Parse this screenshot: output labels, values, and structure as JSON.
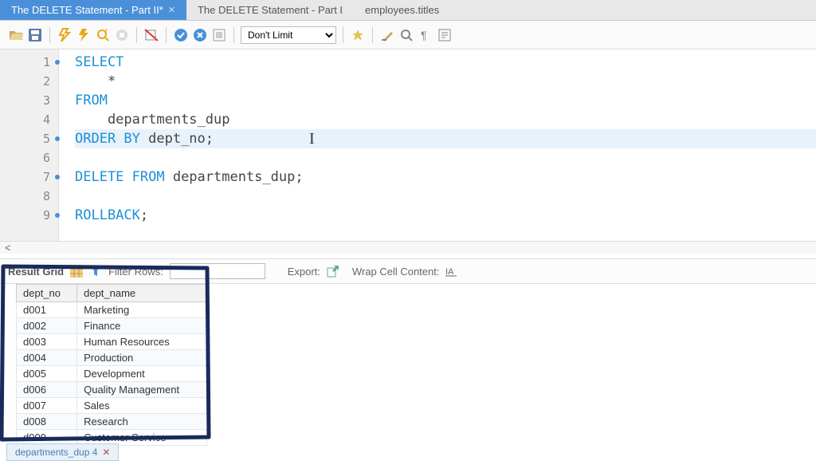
{
  "tabs": [
    {
      "label": "The DELETE Statement - Part II*",
      "active": true
    },
    {
      "label": "The DELETE Statement - Part I",
      "active": false
    },
    {
      "label": "employees.titles",
      "active": false
    }
  ],
  "toolbar": {
    "limit_label": "Don't Limit"
  },
  "editor": {
    "lines": [
      {
        "n": 1,
        "dot": true,
        "tokens": [
          {
            "t": "SELECT",
            "c": "kw"
          }
        ]
      },
      {
        "n": 2,
        "dot": false,
        "tokens": [
          {
            "t": "    *",
            "c": "txt"
          }
        ]
      },
      {
        "n": 3,
        "dot": false,
        "tokens": [
          {
            "t": "FROM",
            "c": "kw"
          }
        ]
      },
      {
        "n": 4,
        "dot": false,
        "tokens": [
          {
            "t": "    departments_dup",
            "c": "txt"
          }
        ]
      },
      {
        "n": 5,
        "dot": true,
        "tokens": [
          {
            "t": "ORDER BY",
            "c": "kw"
          },
          {
            "t": " dept_no;",
            "c": "txt"
          }
        ],
        "highlight": true,
        "cursor": true
      },
      {
        "n": 6,
        "dot": false,
        "tokens": []
      },
      {
        "n": 7,
        "dot": true,
        "tokens": [
          {
            "t": "DELETE FROM",
            "c": "kw"
          },
          {
            "t": " departments_dup;",
            "c": "txt"
          }
        ]
      },
      {
        "n": 8,
        "dot": false,
        "tokens": []
      },
      {
        "n": 9,
        "dot": true,
        "tokens": [
          {
            "t": "ROLLBACK",
            "c": "kw"
          },
          {
            "t": ";",
            "c": "txt"
          }
        ]
      }
    ]
  },
  "results_toolbar": {
    "grid_label": "Result Grid",
    "filter_label": "Filter Rows:",
    "export_label": "Export:",
    "wrap_label": "Wrap Cell Content:"
  },
  "grid": {
    "columns": [
      "dept_no",
      "dept_name"
    ],
    "rows": [
      [
        "d001",
        "Marketing"
      ],
      [
        "d002",
        "Finance"
      ],
      [
        "d003",
        "Human Resources"
      ],
      [
        "d004",
        "Production"
      ],
      [
        "d005",
        "Development"
      ],
      [
        "d006",
        "Quality Management"
      ],
      [
        "d007",
        "Sales"
      ],
      [
        "d008",
        "Research"
      ],
      [
        "d009",
        "Customer Service"
      ]
    ]
  },
  "bottom_tab": {
    "label": "departments_dup 4"
  }
}
